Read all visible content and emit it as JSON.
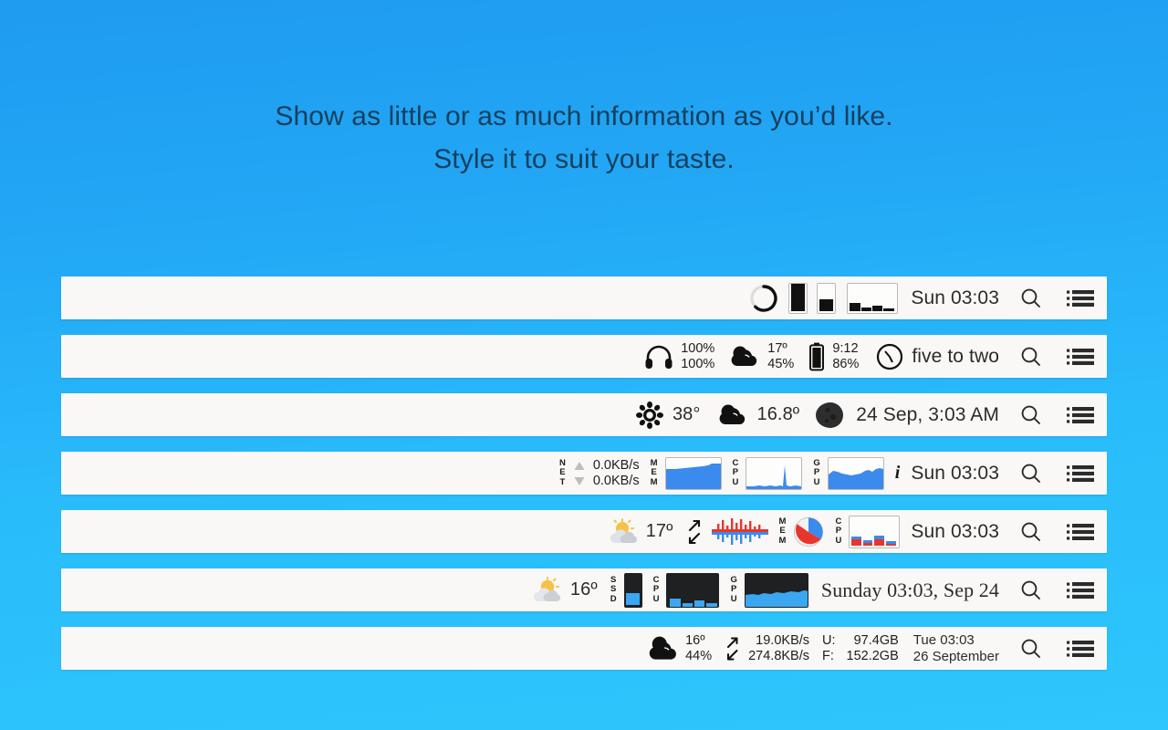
{
  "headline": {
    "line1": "Show as little or as much information as you’d like.",
    "line2": "Style it to suit your taste."
  },
  "colors": {
    "background_top": "#1f9bf0",
    "background_bottom": "#2ec6fc",
    "bar_background": "#f9f8f6",
    "text": "#2b2b2b",
    "graph_blue": "#3b8aed",
    "graph_blue_bright": "#3aa7f0",
    "graph_red": "#e8362c",
    "dark_panel": "#1f2022"
  },
  "system_icons": {
    "search": "search-icon",
    "list": "list-icon"
  },
  "menubars": [
    {
      "id": "row-1",
      "clock": "Sun 03:03",
      "widgets": [
        {
          "type": "ring-gauge",
          "name": "ring-gauge-widget",
          "value": 78
        },
        {
          "type": "vertical-bar",
          "name": "vertical-bar-full-widget",
          "value": 100
        },
        {
          "type": "vertical-bar",
          "name": "vertical-bar-partial-widget",
          "value": 40
        },
        {
          "type": "bar-chart",
          "name": "bar-chart-widget",
          "values": [
            38,
            16,
            22,
            14
          ]
        }
      ]
    },
    {
      "id": "row-2",
      "clock": "five to two",
      "clock_icon": "clock-icon",
      "widgets": [
        {
          "type": "readout",
          "name": "headphones-widget",
          "icon": "headphones-icon",
          "line1": "100%",
          "line2": "100%"
        },
        {
          "type": "readout",
          "name": "weather-widget",
          "icon": "cloud-icon",
          "line1": "17º",
          "line2": "45%"
        },
        {
          "type": "readout",
          "name": "battery-widget",
          "icon": "battery-icon",
          "line1": "9:12",
          "line2": "86%"
        }
      ]
    },
    {
      "id": "row-3",
      "clock": "24 Sep, 3:03 AM",
      "clock_icon": "moon-phase-icon",
      "widgets": [
        {
          "type": "readout1",
          "name": "fan-temp-widget",
          "icon": "fan-icon",
          "value": "38°"
        },
        {
          "type": "readout1",
          "name": "weather-widget",
          "icon": "cloud-icon",
          "value": "16.8º"
        }
      ]
    },
    {
      "id": "row-4",
      "clock": "Sun 03:03",
      "info_icon": "info-icon",
      "widgets": [
        {
          "type": "net",
          "name": "network-widget",
          "label": "NET",
          "up": "0.0KB/s",
          "down": "0.0KB/s"
        },
        {
          "type": "graph",
          "name": "mem-graph-widget",
          "label": "MEM",
          "style": "light",
          "series": [
            70,
            70,
            70,
            70,
            71,
            71,
            71,
            72,
            72,
            72,
            73,
            73,
            74,
            74,
            74,
            75,
            76,
            78,
            80,
            80,
            80,
            80,
            80,
            80
          ]
        },
        {
          "type": "graph",
          "name": "cpu-graph-widget",
          "label": "CPU",
          "style": "light",
          "series": [
            5,
            4,
            5,
            6,
            5,
            4,
            5,
            6,
            7,
            6,
            5,
            4,
            5,
            6,
            5,
            4,
            6,
            60,
            92,
            30,
            8,
            6,
            5,
            6
          ]
        },
        {
          "type": "graph",
          "name": "gpu-graph-widget",
          "label": "GPU",
          "style": "light",
          "series": [
            52,
            62,
            60,
            58,
            56,
            55,
            54,
            52,
            50,
            48,
            50,
            52,
            50,
            48,
            50,
            52,
            56,
            60,
            66,
            64,
            62,
            66,
            68,
            66
          ]
        }
      ]
    },
    {
      "id": "row-5",
      "clock": "Sun 03:03",
      "widgets": [
        {
          "type": "readout1",
          "name": "weather-widget",
          "icon": "sun-cloud-icon",
          "value": "17º"
        },
        {
          "type": "net-arrows",
          "name": "network-arrows-icon"
        },
        {
          "type": "waveform",
          "name": "network-waveform-widget"
        },
        {
          "type": "pie",
          "name": "mem-pie-widget",
          "label": "MEM",
          "blue_pct": 32,
          "red_pct": 55
        },
        {
          "type": "bars-color",
          "name": "cpu-bars-widget",
          "label": "CPU",
          "values": [
            22,
            13,
            26,
            11
          ]
        }
      ]
    },
    {
      "id": "row-6",
      "clock": "Sunday 03:03, Sep 24",
      "clock_style": "serif",
      "widgets": [
        {
          "type": "readout1",
          "name": "weather-widget",
          "icon": "sun-cloud-icon",
          "value": "16º"
        },
        {
          "type": "vbar-dark",
          "name": "ssd-bar-widget",
          "label": "SSD",
          "value": 35
        },
        {
          "type": "bars-dark",
          "name": "cpu-bars-dark-widget",
          "label": "CPU",
          "values": [
            24,
            10,
            18,
            11
          ]
        },
        {
          "type": "graph-dark",
          "name": "gpu-graph-dark-widget",
          "label": "GPU",
          "series": [
            40,
            42,
            41,
            43,
            42,
            44,
            43,
            45,
            44,
            46,
            45,
            47,
            46,
            48,
            47,
            49,
            48,
            50,
            49,
            51,
            50,
            52,
            51,
            52
          ]
        }
      ]
    },
    {
      "id": "row-7",
      "clock_line1": "Tue 03:03",
      "clock_line2": "26 September",
      "widgets": [
        {
          "type": "readout",
          "name": "weather-widget",
          "icon": "cloud-dark-icon",
          "line1": "16º",
          "line2": "44%"
        },
        {
          "type": "net2",
          "name": "network-speed-widget",
          "icon": "net-arrows-icon",
          "line1": "19.0KB/s",
          "line2": "274.8KB/s"
        },
        {
          "type": "disk",
          "name": "disk-usage-widget",
          "key1": "U:",
          "val1": "97.4GB",
          "key2": "F:",
          "val2": "152.2GB"
        }
      ]
    }
  ]
}
